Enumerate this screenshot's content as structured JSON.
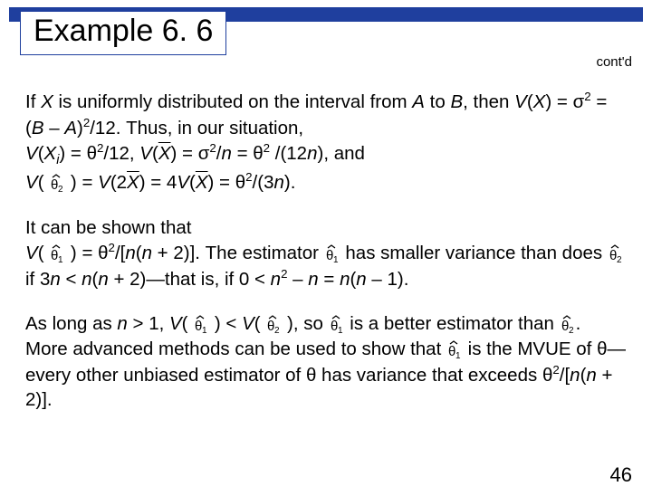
{
  "header": {
    "title": "Example 6. 6",
    "contd": "cont'd"
  },
  "p1": {
    "t1": "If ",
    "t2": "X",
    "t3": " is uniformly distributed on the interval from ",
    "t4": "A",
    "t5": " to ",
    "t6": "B",
    "t7": ", then ",
    "t8": "V",
    "t9": "(",
    "t10": "X",
    "t11": ") = ",
    "t12": "σ",
    "t13": "2",
    "t14": " = (",
    "t15": "B",
    "t16": " – ",
    "t17": "A",
    "t18": ")",
    "t19": "2",
    "t20": "/12. Thus, in our situation, ",
    "t21": "V",
    "t22": "(",
    "t23": "X",
    "t24": "i",
    "t25": ") = ",
    "t26": "θ",
    "t27": "2",
    "t28": "/12, ",
    "t29": "V",
    "t30": "(",
    "t31": "X",
    "t32": ") = ",
    "t33": "σ",
    "t34": "2",
    "t35": "/",
    "t36": "n",
    "t37": " = ",
    "t38": "θ",
    "t39": "2",
    "t40": " /(12",
    "t41": "n",
    "t42": "), and ",
    "t43": "V",
    "t44": "(",
    "t45": ") = ",
    "t46": "V",
    "t47": "(2",
    "t48": "X",
    "t49": ") = 4",
    "t50": "V",
    "t51": "(",
    "t52": "X",
    "t53": ") = ",
    "t54": "θ",
    "t55": "2",
    "t56": "/(3",
    "t57": "n",
    "t58": ")."
  },
  "p2": {
    "t1": "It can be shown that ",
    "t2": "V",
    "t3": "(",
    "t4": ") = ",
    "t5": "θ",
    "t6": "2",
    "t7": "/[",
    "t8": "n",
    "t9": "(",
    "t10": "n",
    "t11": " + 2)]. The estimator ",
    "t12": "has smaller variance than does ",
    "t13": " if 3",
    "t14": "n",
    "t15": " < ",
    "t16": "n",
    "t17": "(",
    "t18": "n",
    "t19": " + 2)—that is, if 0 < ",
    "t20": "n",
    "t21": "2",
    "t22": " – ",
    "t23": "n",
    "t24": " = ",
    "t25": "n",
    "t26": "(",
    "t27": "n",
    "t28": " – 1)."
  },
  "p3": {
    "t1": "As long as ",
    "t2": "n",
    "t3": " > 1, ",
    "t4": "V",
    "t5": "(",
    "t6": ") < ",
    "t7": "V",
    "t8": "(",
    "t9": "), so ",
    "t10": " is a better estimator than ",
    "t11": ". More advanced methods can be used to show that ",
    "t12": " is the MVUE of ",
    "t13": "θ",
    "t14": "—every other unbiased estimator of ",
    "t15": "θ",
    "t16": " has variance that exceeds ",
    "t17": "θ",
    "t18": "2",
    "t19": "/[",
    "t20": "n",
    "t21": "(",
    "t22": "n",
    "t23": " + 2)]."
  },
  "pagenum": "46",
  "sub1": "1",
  "sub2": "2"
}
